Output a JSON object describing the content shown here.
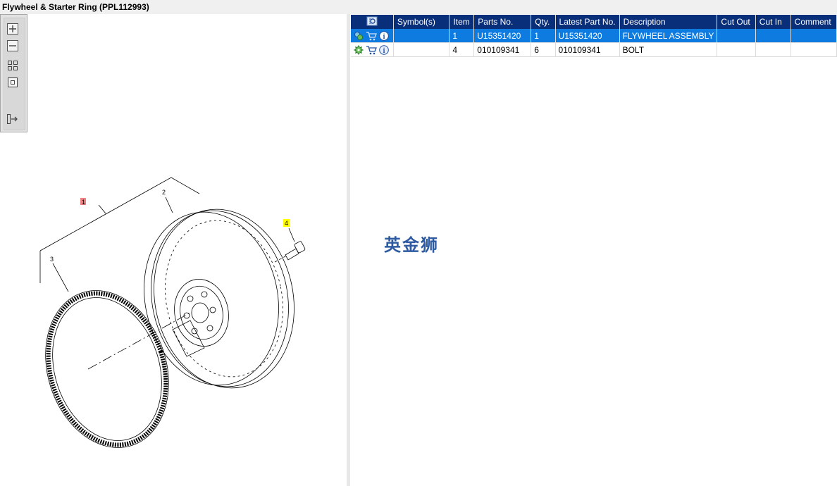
{
  "window": {
    "title": "Flywheel & Starter Ring (PPL112993)"
  },
  "toolbar": {
    "buttons": [
      {
        "name": "zoom-in-icon"
      },
      {
        "name": "zoom-out-icon"
      },
      {
        "name": "fit-all-icon"
      },
      {
        "name": "fit-window-icon"
      },
      {
        "name": "export-icon"
      }
    ]
  },
  "diagram": {
    "callouts": [
      {
        "label": "1",
        "highlight": "#f08080"
      },
      {
        "label": "2"
      },
      {
        "label": "3"
      },
      {
        "label": "4",
        "highlight": "#ffff00"
      }
    ]
  },
  "table": {
    "columns": [
      "Symbol(s)",
      "Item",
      "Parts No.",
      "Qty.",
      "Latest Part No.",
      "Description",
      "Cut Out",
      "Cut In",
      "Comment"
    ],
    "rows": [
      {
        "symbol": "",
        "item": "1",
        "parts_no": "U15351420",
        "qty": "1",
        "latest_part_no": "U15351420",
        "description": "FLYWHEEL ASSEMBLY",
        "cut_out": "",
        "cut_in": "",
        "comment": "",
        "selected": true
      },
      {
        "symbol": "",
        "item": "4",
        "parts_no": "010109341",
        "qty": "6",
        "latest_part_no": "010109341",
        "description": "BOLT",
        "cut_out": "",
        "cut_in": "",
        "comment": "",
        "selected": false
      }
    ]
  },
  "watermark": "英金狮",
  "colors": {
    "header": "#0a2f7a",
    "selected_row": "#0e7be0",
    "accent": "#2d5aa0"
  }
}
